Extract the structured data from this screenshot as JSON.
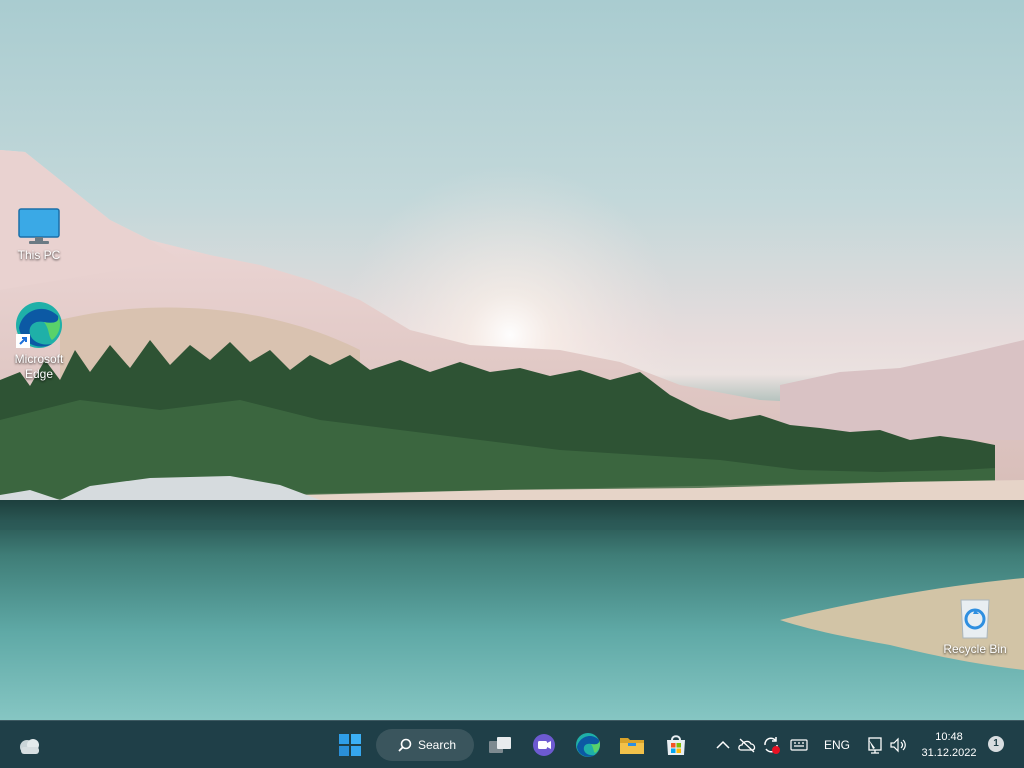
{
  "desktop": {
    "icons": [
      {
        "label": "This PC"
      },
      {
        "label": "Microsoft Edge"
      },
      {
        "label": "Recycle Bin"
      }
    ]
  },
  "taskbar": {
    "search_label": "Search",
    "apps": [
      "start-icon",
      "search-icon",
      "task-view-icon",
      "teams-chat-icon",
      "edge-icon",
      "file-explorer-icon",
      "store-icon"
    ],
    "tray": {
      "language": "ENG",
      "time": "10:48",
      "date": "31.12.2022",
      "notifications": "1"
    }
  },
  "colors": {
    "taskbar": "#1f3f48",
    "start_blue": "#2f9ee8",
    "edge_teal": "#1fb0a8",
    "explorer_yellow": "#f2c14a"
  }
}
